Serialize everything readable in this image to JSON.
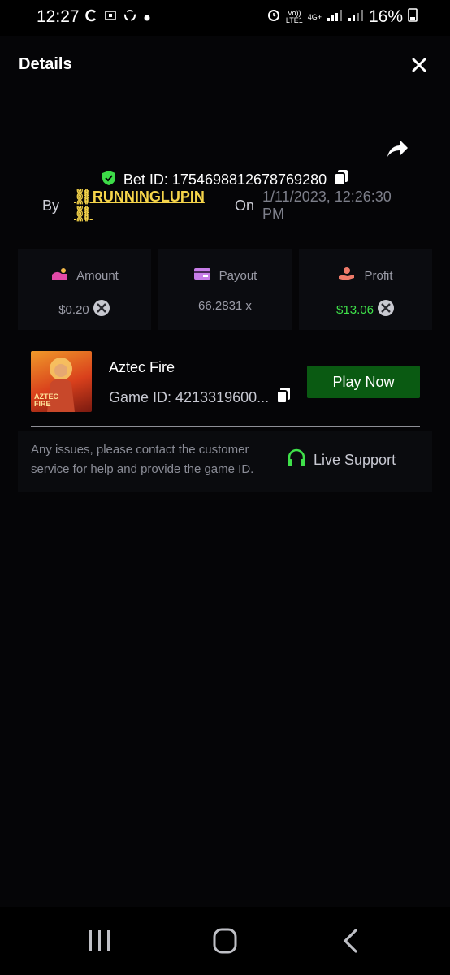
{
  "status_bar": {
    "time": "12:27",
    "network_label_top": "Vo))",
    "network_label_bottom": "LTE1",
    "net_type": "4G+",
    "battery": "16%"
  },
  "header": {
    "title": "Details"
  },
  "bet": {
    "label": "Bet ID: 1754698812678769280",
    "by_label": "By",
    "username": "⛓RUNNINGLUPIN⛓",
    "on_label": "On",
    "datetime": "1/11/2023, 12:26:30 PM"
  },
  "stats": {
    "amount": {
      "label": "Amount",
      "value": "$0.20"
    },
    "payout": {
      "label": "Payout",
      "value": "66.2831 x"
    },
    "profit": {
      "label": "Profit",
      "value": "$13.06"
    }
  },
  "game": {
    "name": "Aztec Fire",
    "game_id": "Game ID: 4213319600...",
    "thumb_text_line1": "AZTEC",
    "thumb_text_line2": "FIRE",
    "play_button": "Play Now"
  },
  "support": {
    "text": "Any issues, please contact the customer service for help and provide the game ID.",
    "button": "Live Support"
  },
  "colors": {
    "accent_green": "#0a5a12",
    "profit_green": "#3fe04a",
    "username_yellow": "#f5d44a",
    "shield_green": "#3ddc48"
  }
}
